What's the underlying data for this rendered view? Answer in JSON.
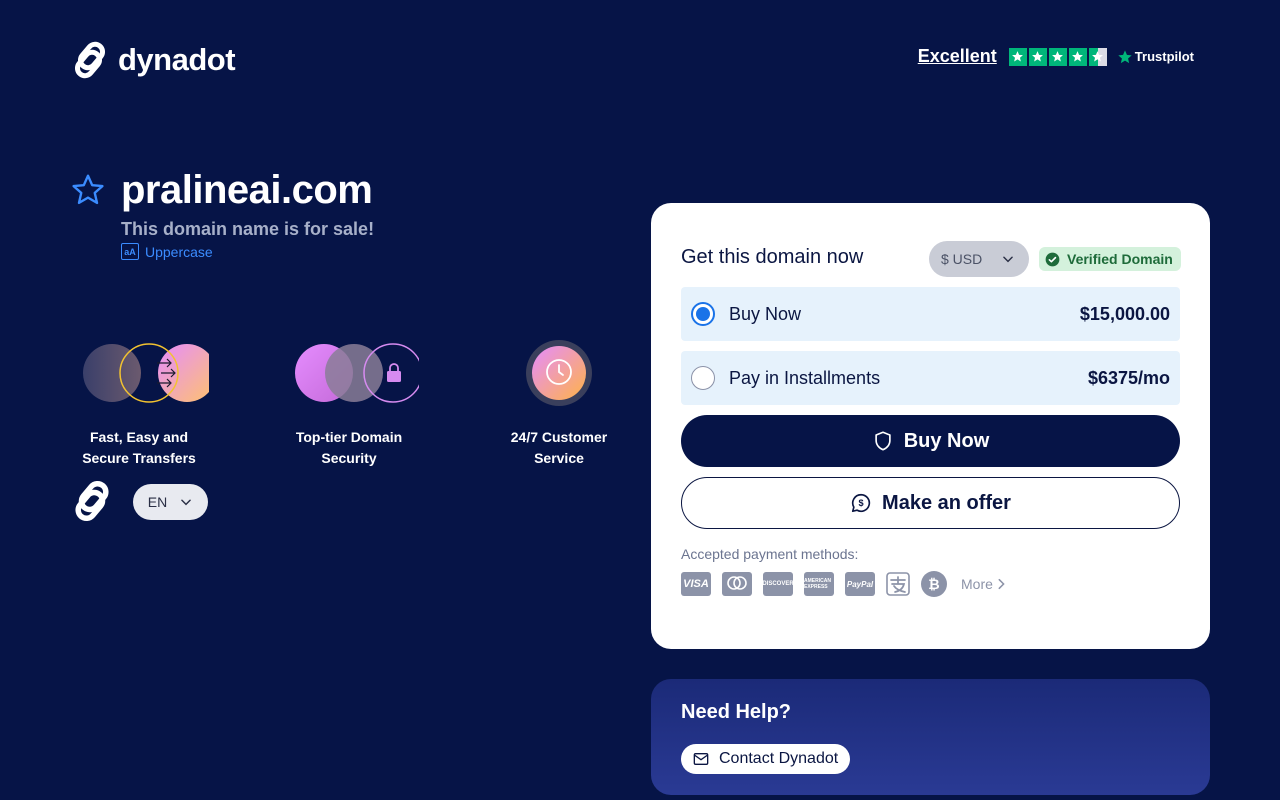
{
  "brand": {
    "name": "dynadot"
  },
  "trustpilot": {
    "rating_text": "Excellent",
    "brand": "Trustpilot",
    "stars": 4.5
  },
  "domain": {
    "name": "pralineai.com",
    "subtitle": "This domain name is for sale!",
    "uppercase_label": "Uppercase",
    "uppercase_icon_text": "aA"
  },
  "features": [
    {
      "label_line1": "Fast, Easy and",
      "label_line2": "Secure Transfers",
      "icon": "transfer-icon"
    },
    {
      "label_line1": "Top-tier Domain",
      "label_line2": "Security",
      "icon": "lock-icon"
    },
    {
      "label_line1": "24/7 Customer",
      "label_line2": "Service",
      "icon": "clock-icon"
    }
  ],
  "language": {
    "selected": "EN"
  },
  "purchase": {
    "title": "Get this domain now",
    "currency": "$ USD",
    "verified": "Verified Domain",
    "options": [
      {
        "label": "Buy Now",
        "price": "$15,000.00",
        "selected": true
      },
      {
        "label": "Pay in Installments",
        "price": "$6375/mo",
        "selected": false
      }
    ],
    "buy_button": "Buy Now",
    "offer_button": "Make an offer",
    "payment_label": "Accepted payment methods:",
    "payment_methods": {
      "visa": "VISA",
      "discover": "DISCOVER",
      "amex": "AMERICAN EXPRESS",
      "paypal": "PayPal",
      "bitcoin": "₿"
    },
    "more_label": "More"
  },
  "help": {
    "title": "Need Help?",
    "contact_button": "Contact Dynadot"
  },
  "colors": {
    "background": "#061447",
    "accent_blue": "#1a73e8",
    "trustpilot_green": "#00b67a",
    "verified_green": "#1e6b3a"
  }
}
